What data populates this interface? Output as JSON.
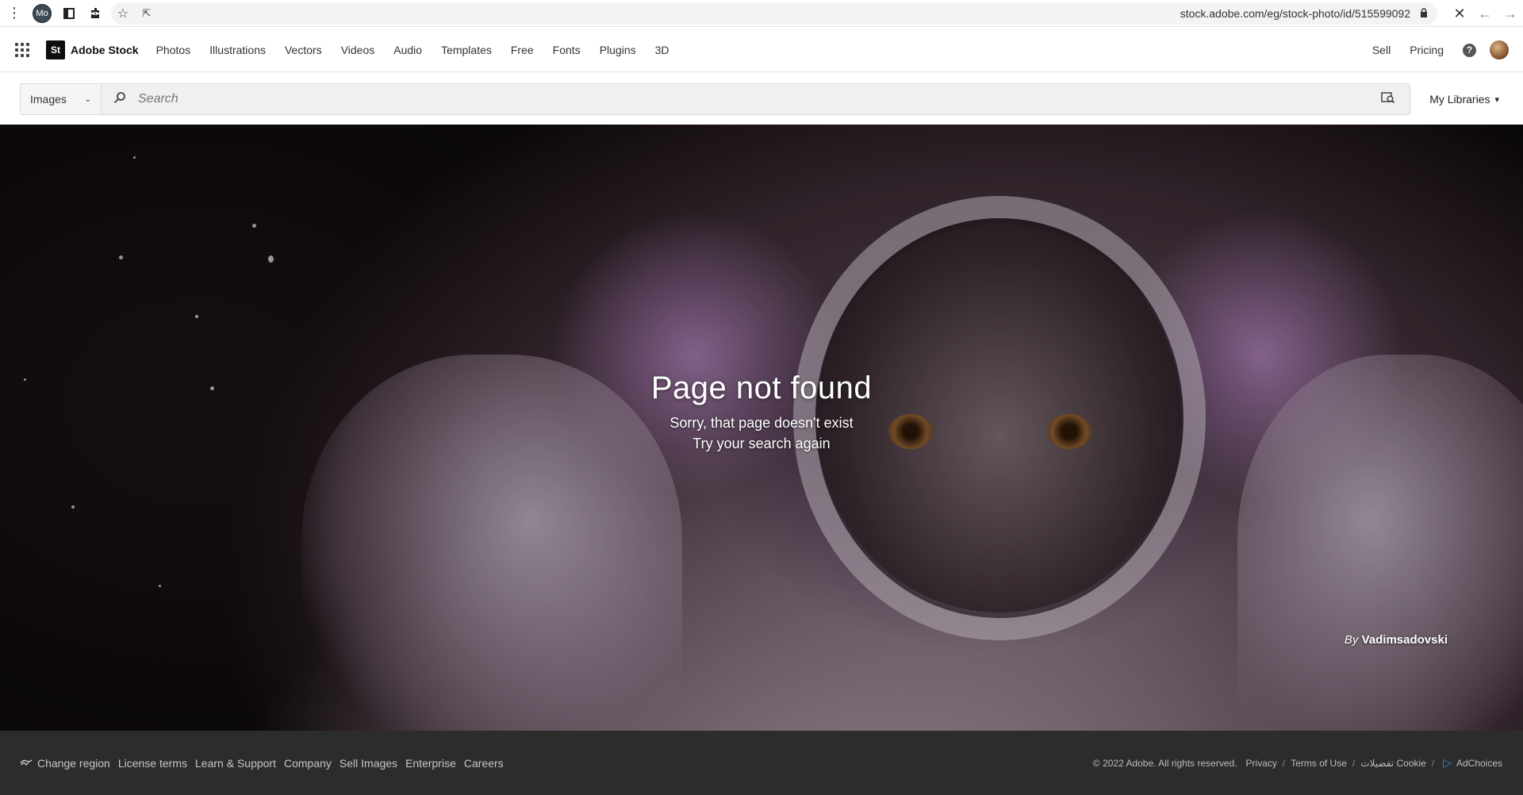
{
  "browser": {
    "profile_initials": "Mo",
    "url": "stock.adobe.com/eg/stock-photo/id/515599092"
  },
  "header": {
    "brand_mark": "St",
    "brand_name": "Adobe Stock",
    "nav": [
      "Photos",
      "Illustrations",
      "Vectors",
      "Videos",
      "Audio",
      "Templates",
      "Free",
      "Fonts",
      "Plugins",
      "3D"
    ],
    "sell": "Sell",
    "pricing": "Pricing",
    "help": "?"
  },
  "search": {
    "type_value": "Images",
    "placeholder": "Search",
    "my_libraries": "My Libraries"
  },
  "hero": {
    "title": "Page not found",
    "line1": "Sorry, that page doesn't exist",
    "line2": "Try your search again",
    "credit_by": "By",
    "credit_author": "Vadimsadovski"
  },
  "footer": {
    "links": [
      "Change region",
      "License terms",
      "Learn & Support",
      "Company",
      "Sell Images",
      "Enterprise",
      "Careers"
    ],
    "copyright": "© 2022 Adobe. All rights reserved.",
    "privacy": "Privacy",
    "terms": "Terms of Use",
    "cookie": "تفضيلات Cookie",
    "adchoices": "AdChoices"
  },
  "colors": {
    "footer_bg": "#2c2c2c",
    "brand_mark_bg": "#0e0e0e",
    "adchoices_accent": "#3d8ee8"
  }
}
